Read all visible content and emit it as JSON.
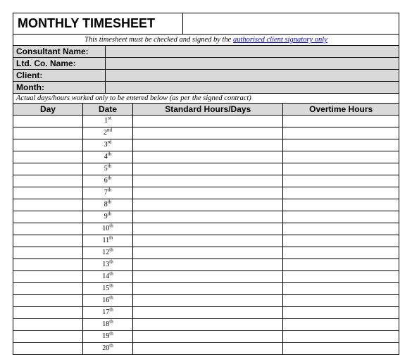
{
  "title": "MONTHLY TIMESHEET",
  "note_prefix": "This timesheet must be checked and signed by the ",
  "note_link": "authorised client signatory only",
  "info_rows": [
    {
      "label": "Consultant Name:",
      "value": ""
    },
    {
      "label": "Ltd. Co. Name:",
      "value": ""
    },
    {
      "label": "Client:",
      "value": ""
    },
    {
      "label": "Month:",
      "value": ""
    }
  ],
  "instruction": "Actual days/hours worked only to be entered below (as per the signed contract)",
  "columns": [
    "Day",
    "Date",
    "Standard Hours/Days",
    "Overtime Hours"
  ],
  "rows": [
    {
      "day": "",
      "date_num": "1",
      "date_suffix": "st",
      "std": "",
      "ot": ""
    },
    {
      "day": "",
      "date_num": "2",
      "date_suffix": "nd",
      "std": "",
      "ot": ""
    },
    {
      "day": "",
      "date_num": "3",
      "date_suffix": "rd",
      "std": "",
      "ot": ""
    },
    {
      "day": "",
      "date_num": "4",
      "date_suffix": "th",
      "std": "",
      "ot": ""
    },
    {
      "day": "",
      "date_num": "5",
      "date_suffix": "th",
      "std": "",
      "ot": ""
    },
    {
      "day": "",
      "date_num": "6",
      "date_suffix": "th",
      "std": "",
      "ot": ""
    },
    {
      "day": "",
      "date_num": "7",
      "date_suffix": "th",
      "std": "",
      "ot": ""
    },
    {
      "day": "",
      "date_num": "8",
      "date_suffix": "th",
      "std": "",
      "ot": ""
    },
    {
      "day": "",
      "date_num": "9",
      "date_suffix": "th",
      "std": "",
      "ot": ""
    },
    {
      "day": "",
      "date_num": "10",
      "date_suffix": "th",
      "std": "",
      "ot": ""
    },
    {
      "day": "",
      "date_num": "11",
      "date_suffix": "th",
      "std": "",
      "ot": ""
    },
    {
      "day": "",
      "date_num": "12",
      "date_suffix": "th",
      "std": "",
      "ot": ""
    },
    {
      "day": "",
      "date_num": "13",
      "date_suffix": "th",
      "std": "",
      "ot": ""
    },
    {
      "day": "",
      "date_num": "14",
      "date_suffix": "th",
      "std": "",
      "ot": ""
    },
    {
      "day": "",
      "date_num": "15",
      "date_suffix": "th",
      "std": "",
      "ot": ""
    },
    {
      "day": "",
      "date_num": "16",
      "date_suffix": "th",
      "std": "",
      "ot": ""
    },
    {
      "day": "",
      "date_num": "17",
      "date_suffix": "th",
      "std": "",
      "ot": ""
    },
    {
      "day": "",
      "date_num": "18",
      "date_suffix": "th",
      "std": "",
      "ot": ""
    },
    {
      "day": "",
      "date_num": "19",
      "date_suffix": "th",
      "std": "",
      "ot": ""
    },
    {
      "day": "",
      "date_num": "20",
      "date_suffix": "th",
      "std": "",
      "ot": ""
    }
  ]
}
